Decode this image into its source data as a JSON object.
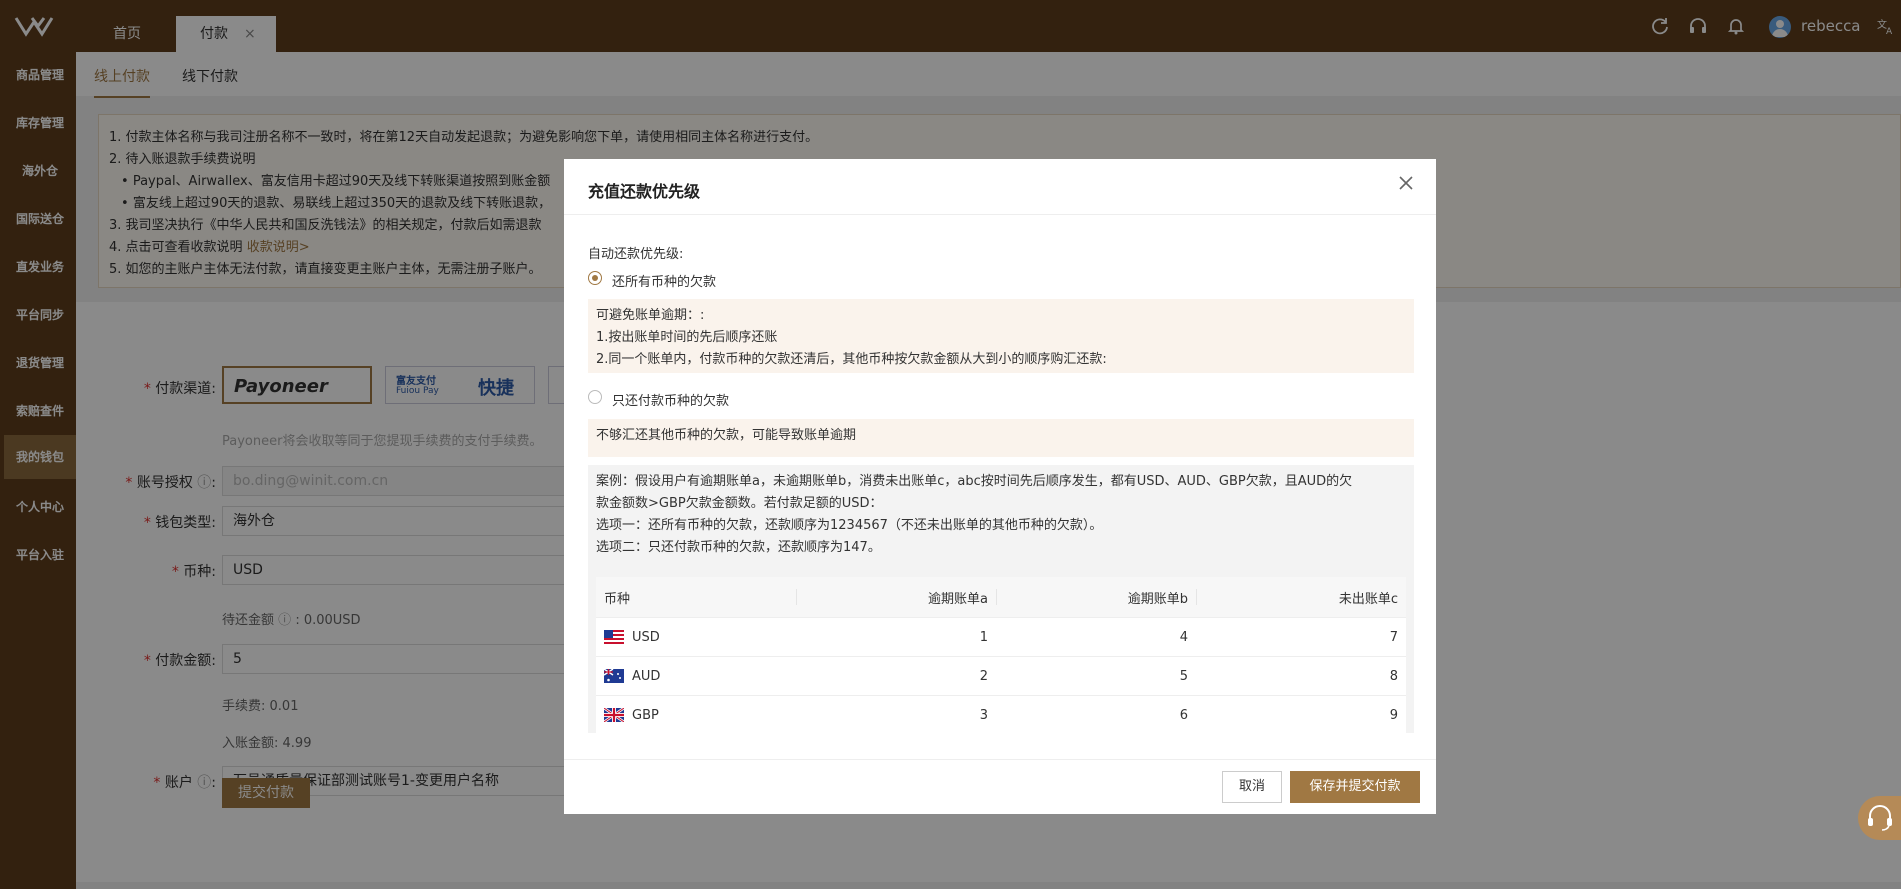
{
  "topbar": {
    "tabs": [
      {
        "label": "首页"
      },
      {
        "label": "付款",
        "close": "×"
      }
    ],
    "user": {
      "name": "rebecca"
    },
    "icons": [
      "refresh-icon",
      "headset-icon",
      "bell-icon",
      "translate-icon"
    ],
    "colors": {
      "bar": "#5e3e1c",
      "accent": "#a07843"
    }
  },
  "sidebar": {
    "items": [
      {
        "label": "商品管理"
      },
      {
        "label": "库存管理"
      },
      {
        "label": "海外仓"
      },
      {
        "label": "国际送仓"
      },
      {
        "label": "直发业务"
      },
      {
        "label": "平台同步"
      },
      {
        "label": "退货管理"
      },
      {
        "label": "索赔查件"
      },
      {
        "label": "我的钱包",
        "active": true
      },
      {
        "label": "个人中心"
      },
      {
        "label": "平台入驻"
      }
    ]
  },
  "main": {
    "subtabs": [
      {
        "label": "线上付款",
        "active": true
      },
      {
        "label": "线下付款"
      }
    ],
    "notice": {
      "line1": "1. 付款主体名称与我司注册名称不一致时，将在第12天自动发起退款；为避免影响您下单，请使用相同主体名称进行支付。",
      "line2": "2. 待入账退款手续费说明",
      "bullet1": "Paypal、Airwallex、富友信用卡超过90天及线下转账渠道按照到账金额",
      "bullet2": "富友线上超过90天的退款、易联线上超过350天的退款及线下转账退款，",
      "line3": "3. 我司坚决执行《中华人民共和国反洗钱法》的相关规定，付款后如需退款",
      "line4_prefix": "4. 点击可查看收款说明",
      "line4_link": "收款说明>",
      "line5": "5. 如您的主账户主体无法付款，请直接变更主账户主体，无需注册子账户。"
    },
    "form": {
      "channel_label": "付款渠道:",
      "channel_payoneer": "Payoneer",
      "channel_fuiou_cn": "富友支付",
      "channel_fuiou_en": "Fuiou Pay",
      "channel_fuiou_tag": "快捷",
      "payoneer_note": "Payoneer将会收取等同于您提现手续费的支付手续费。",
      "auth_label": "账号授权",
      "auth_placeholder": "bo.ding@winit.com.cn",
      "wallet_label": "钱包类型:",
      "wallet_value": "海外仓",
      "currency_label": "币种:",
      "currency_value": "USD",
      "pending_label": "待还金额",
      "pending_value": ": 0.00USD",
      "amount_label": "付款金额:",
      "amount_value": "5",
      "fee_label": "手续费:",
      "fee_value": "0.01",
      "received_label": "入账金额:",
      "received_value": "4.99",
      "account_label": "账户",
      "account_value": "万邑通质量保证部测试账号1-变更用户名称",
      "submit": "提交付款"
    }
  },
  "modal": {
    "title": "充值还款优先级",
    "auto_label": "自动还款优先级:",
    "option1": {
      "label": "还所有币种的欠款",
      "checked": true,
      "tip_title": "可避免账单逾期：:",
      "tip_line1": "1.按出账单时间的先后顺序还账",
      "tip_line2": "2.同一个账单内，付款币种的欠款还清后，其他币种按欠款金额从大到小的顺序购汇还款:"
    },
    "option2": {
      "label": "只还付款币种的欠款",
      "checked": false,
      "tip": "不够汇还其他币种的欠款，可能导致账单逾期"
    },
    "case": {
      "line1": "案例：假设用户有逾期账单a，未逾期账单b，消费未出账单c，abc按时间先后顺序发生，都有USD、AUD、GBP欠款，且AUD的欠",
      "line2": "款金额数>GBP欠款金额数。若付款足额的USD：",
      "line3": "选项一：还所有币种的欠款，还款顺序为1234567（不还未出账单的其他币种的欠款）。",
      "line4": "选项二：只还付款币种的欠款，还款顺序为147。"
    },
    "table": {
      "headers": [
        "币种",
        "逾期账单a",
        "逾期账单b",
        "未出账单c"
      ],
      "rows": [
        {
          "currency": "USD",
          "flag": "us-flag-icon",
          "a": "1",
          "b": "4",
          "c": "7"
        },
        {
          "currency": "AUD",
          "flag": "au-flag-icon",
          "a": "2",
          "b": "5",
          "c": "8"
        },
        {
          "currency": "GBP",
          "flag": "gb-flag-icon",
          "a": "3",
          "b": "6",
          "c": "9"
        }
      ]
    },
    "cancel": "取消",
    "save": "保存并提交付款"
  }
}
